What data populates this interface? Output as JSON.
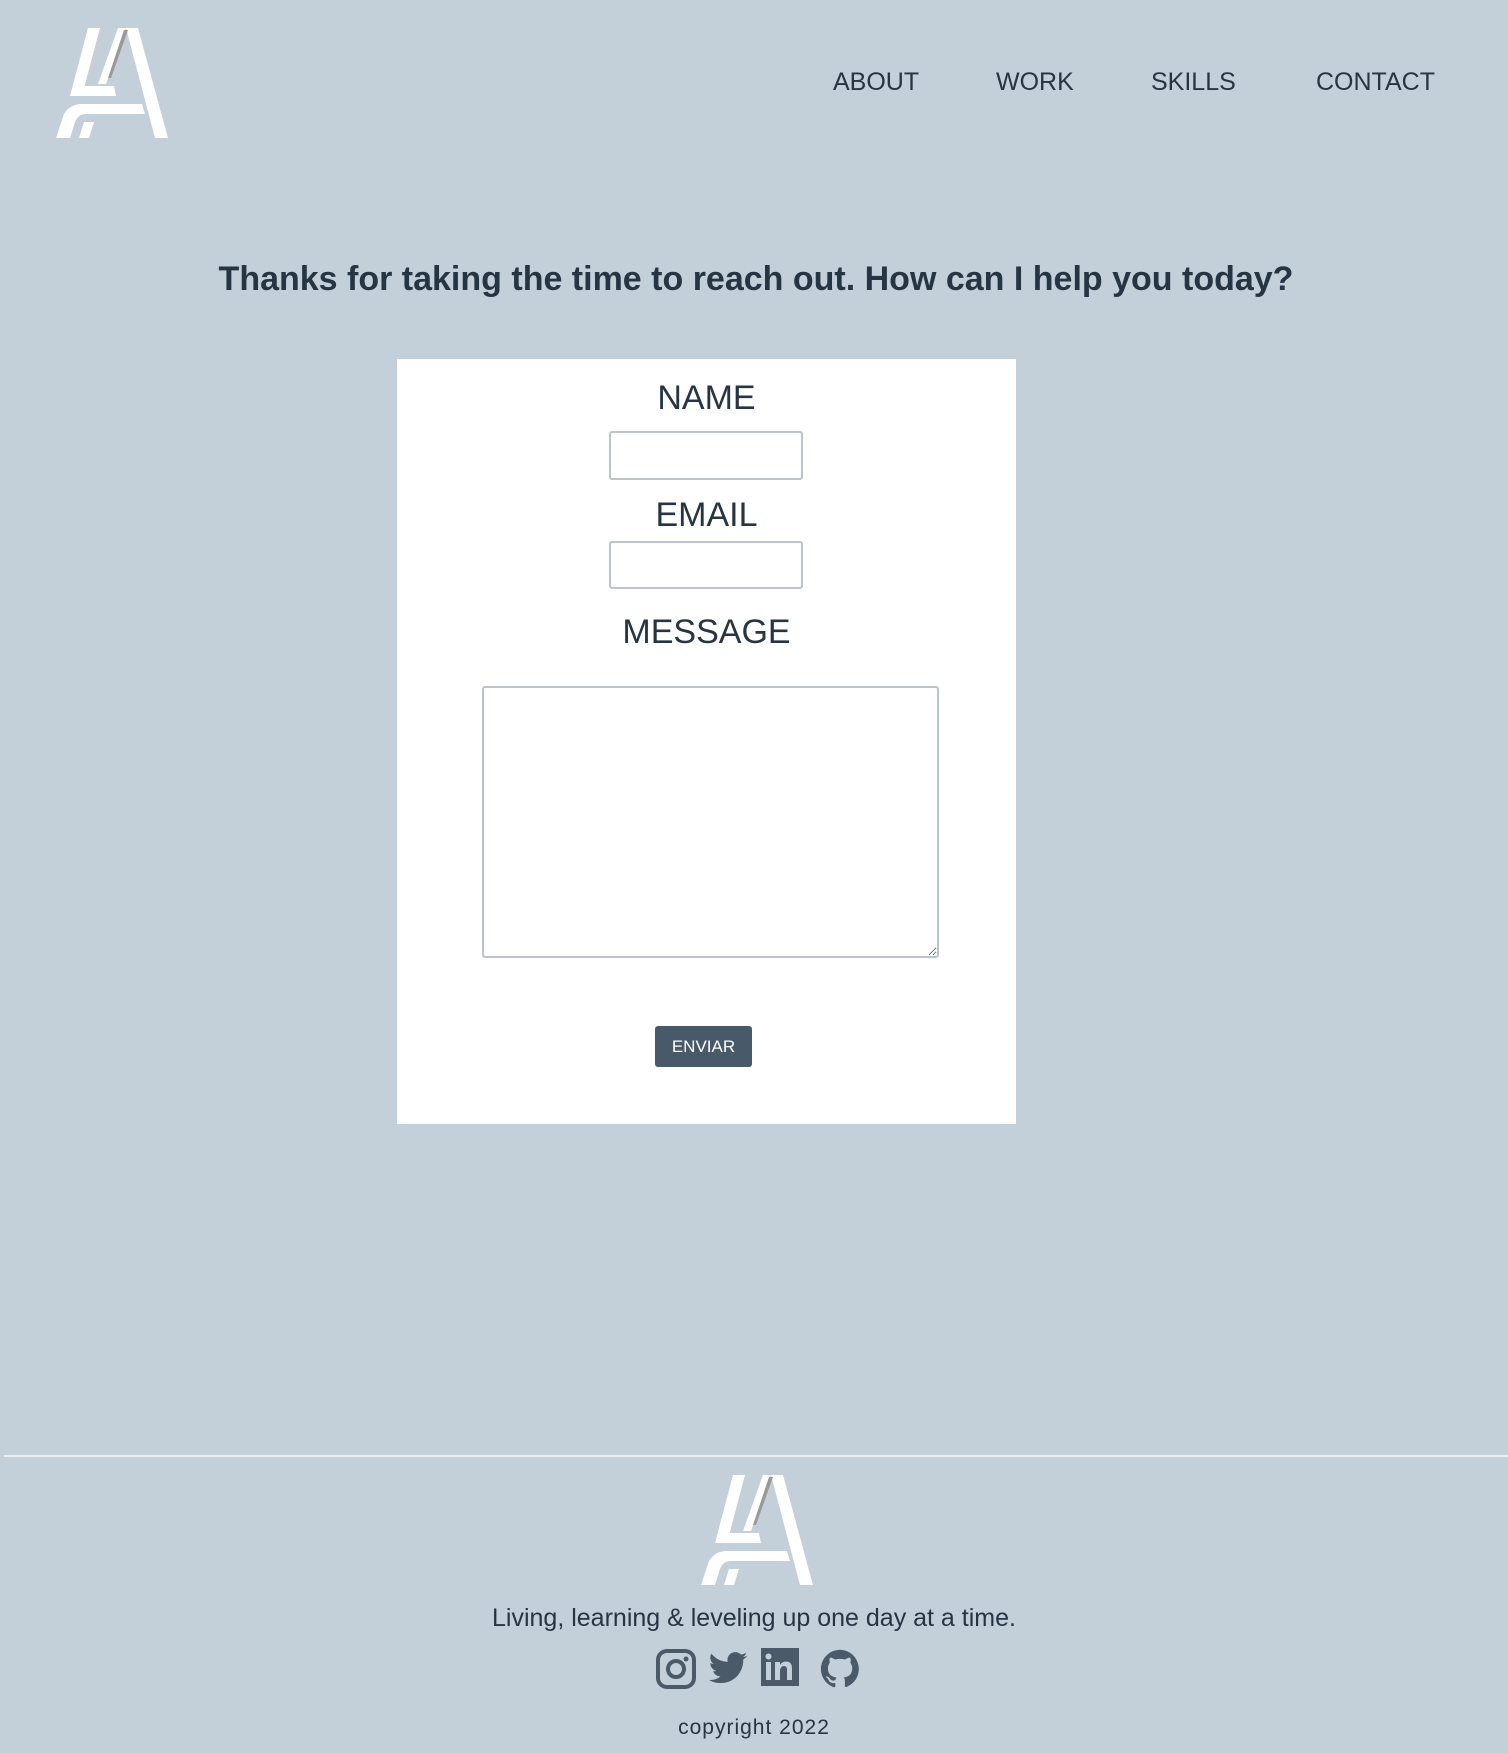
{
  "nav": {
    "items": [
      "ABOUT",
      "WORK",
      "SKILLS",
      "CONTACT"
    ]
  },
  "heading": "Thanks for taking the time to reach out. How can I help you today?",
  "form": {
    "name_label": "NAME",
    "name_value": "",
    "email_label": "EMAIL",
    "email_value": "",
    "message_label": "MESSAGE",
    "message_value": "",
    "submit_label": "ENVIAR"
  },
  "footer": {
    "tagline": "Living, learning & leveling up one day at a time.",
    "social": [
      "instagram-icon",
      "twitter-icon",
      "linkedin-icon",
      "github-icon"
    ],
    "copyright": "copyright  2022"
  },
  "colors": {
    "background": "#c3cfd9",
    "text": "#263544",
    "button": "#485969"
  }
}
